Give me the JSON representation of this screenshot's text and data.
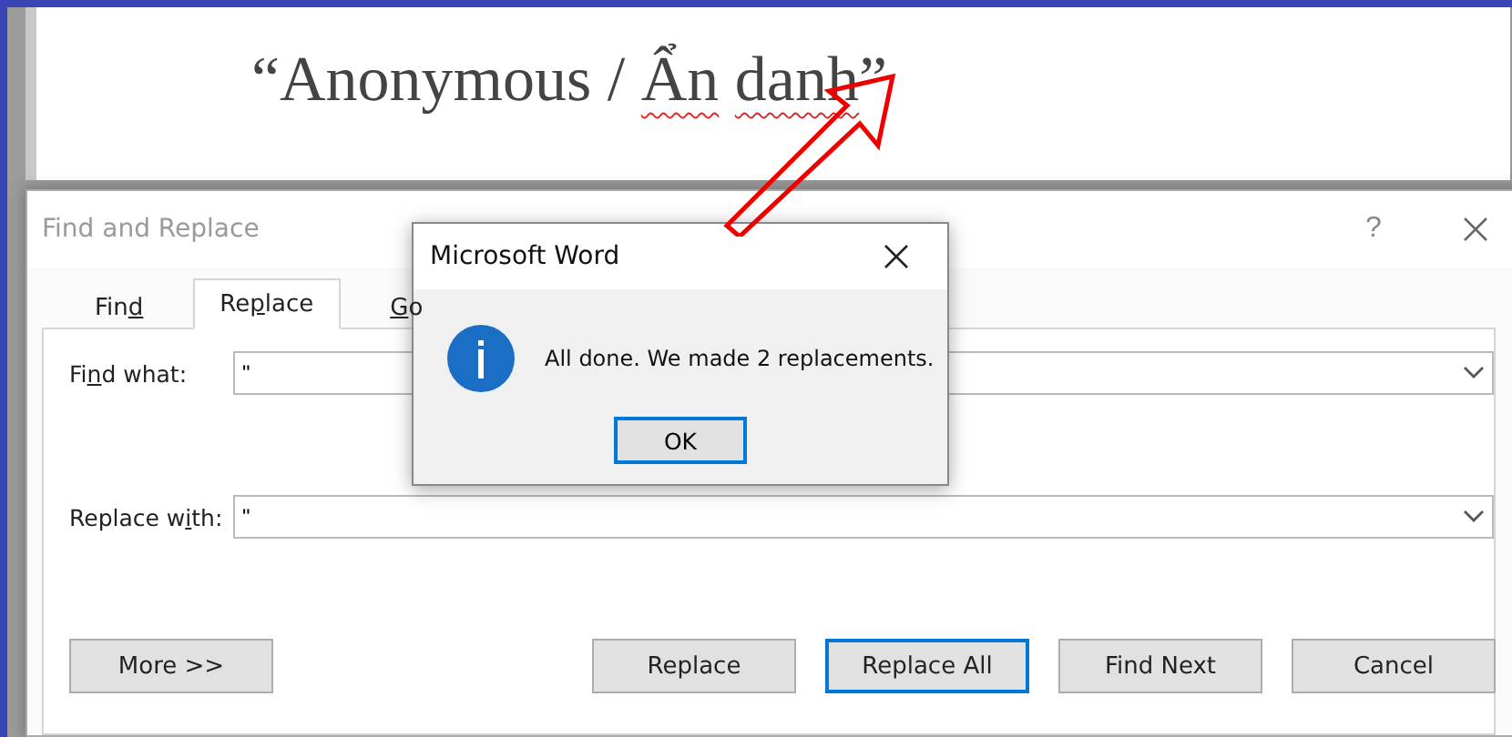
{
  "document": {
    "heading": [
      {
        "text": "“Anonymous /",
        "misspelled": false,
        "gap_before": false
      },
      {
        "text": "Ẩn",
        "misspelled": true,
        "gap_before": true
      },
      {
        "text": "danh",
        "misspelled": true,
        "gap_before": true
      },
      {
        "text": "”",
        "misspelled": false,
        "gap_before": false
      }
    ]
  },
  "find_replace": {
    "title": "Find and Replace",
    "help": "?",
    "tabs": [
      {
        "before": "Fin",
        "key": "d",
        "selected": false
      },
      {
        "before": "Re",
        "key": "p",
        "after": "lace",
        "selected": true
      },
      {
        "key": "G",
        "after": "o",
        "selected": false
      }
    ],
    "fields": [
      {
        "before": "Fi",
        "key": "n",
        "after": "d what:",
        "value": "\""
      },
      {
        "before": "Replace w",
        "key": "i",
        "after": "th:",
        "value": "\""
      }
    ],
    "buttons": [
      {
        "label": "More >>",
        "default": false
      },
      {
        "label": "Replace",
        "default": false
      },
      {
        "label": "Replace All",
        "default": true
      },
      {
        "label": "Find Next",
        "default": false
      },
      {
        "label": "Cancel",
        "default": false
      }
    ]
  },
  "message_box": {
    "title": "Microsoft Word",
    "message": "All done. We made 2 replacements.",
    "button": "OK"
  }
}
